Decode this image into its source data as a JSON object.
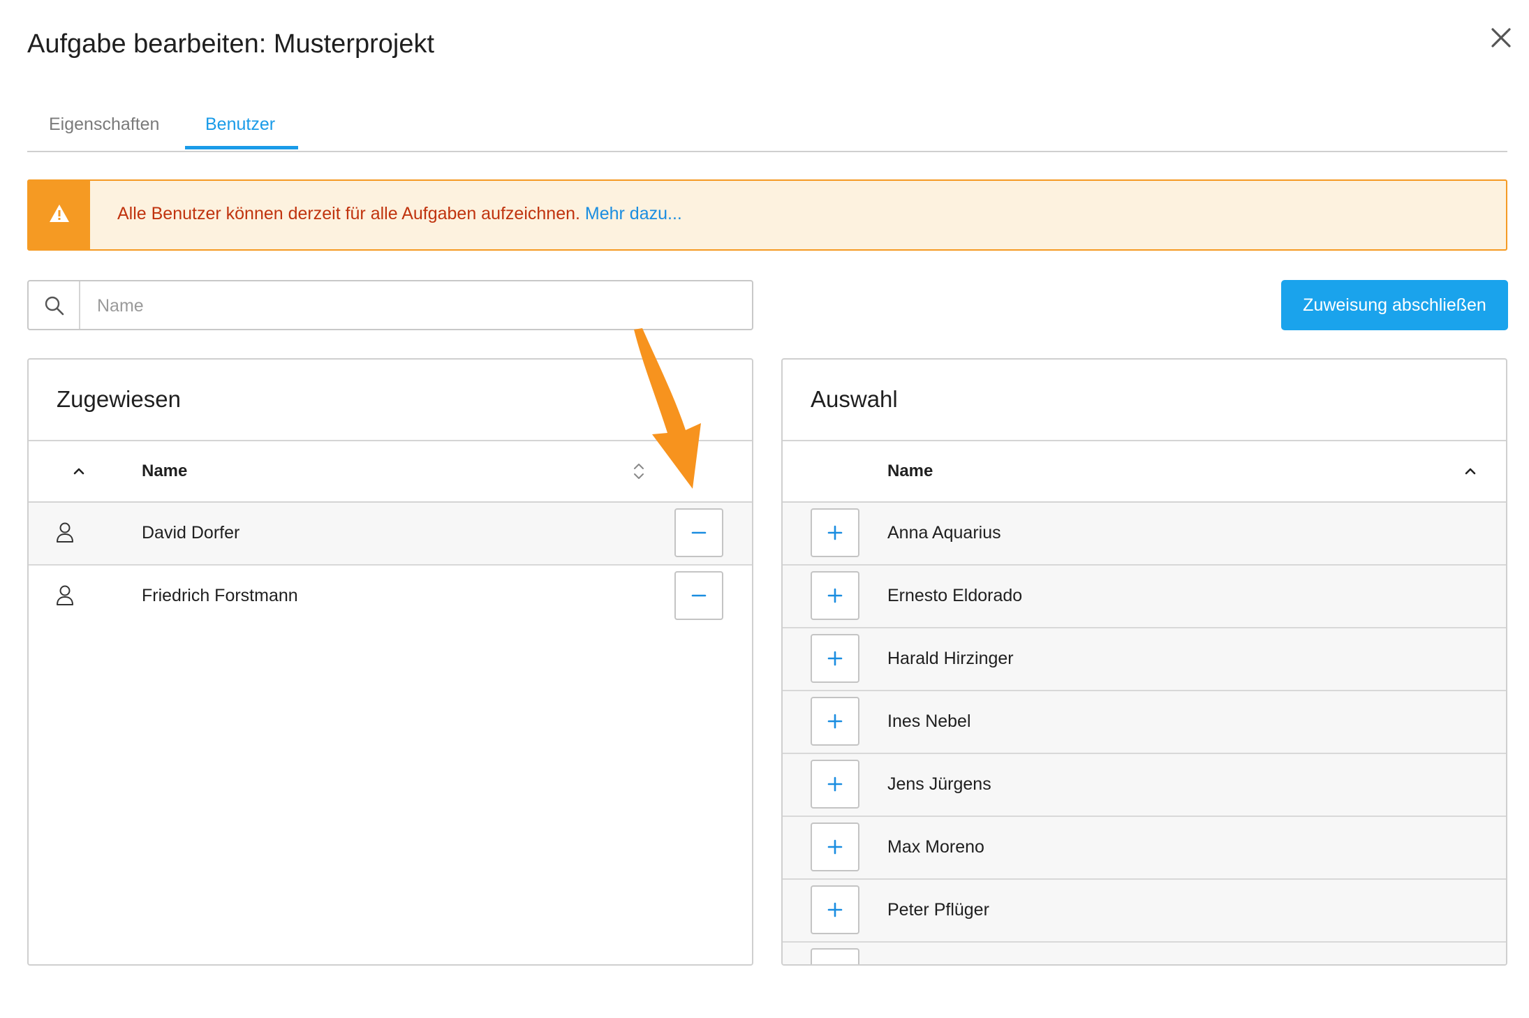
{
  "dialog": {
    "title": "Aufgabe bearbeiten: Musterprojekt"
  },
  "tabs": [
    {
      "label": "Eigenschaften",
      "active": false
    },
    {
      "label": "Benutzer",
      "active": true
    }
  ],
  "alert": {
    "text": "Alle Benutzer können derzeit für alle Aufgaben aufzeichnen.",
    "link": "Mehr dazu..."
  },
  "search": {
    "placeholder": "Name",
    "value": ""
  },
  "actions": {
    "finish_label": "Zuweisung abschließen"
  },
  "assigned": {
    "title": "Zugewiesen",
    "column": "Name",
    "users": [
      {
        "name": "David Dorfer"
      },
      {
        "name": "Friedrich Forstmann"
      }
    ]
  },
  "selection": {
    "title": "Auswahl",
    "column": "Name",
    "users": [
      {
        "name": "Anna Aquarius"
      },
      {
        "name": "Ernesto Eldorado"
      },
      {
        "name": "Harald Hirzinger"
      },
      {
        "name": "Ines Nebel"
      },
      {
        "name": "Jens Jürgens"
      },
      {
        "name": "Max Moreno"
      },
      {
        "name": "Peter Pflüger"
      }
    ]
  },
  "colors": {
    "accent": "#1a9be8",
    "button_primary": "#1aa3ec",
    "warning": "#f59a23",
    "warning_bg": "#fdf2df",
    "warning_text": "#c0330e",
    "annotation_arrow": "#f7931e"
  },
  "icons": {
    "close": "close-icon",
    "warning": "warning-triangle-icon",
    "search": "search-icon",
    "user": "user-icon",
    "remove": "minus-icon",
    "add": "plus-icon",
    "sort_up": "chevron-up-icon",
    "sort": "sort-updown-icon"
  }
}
